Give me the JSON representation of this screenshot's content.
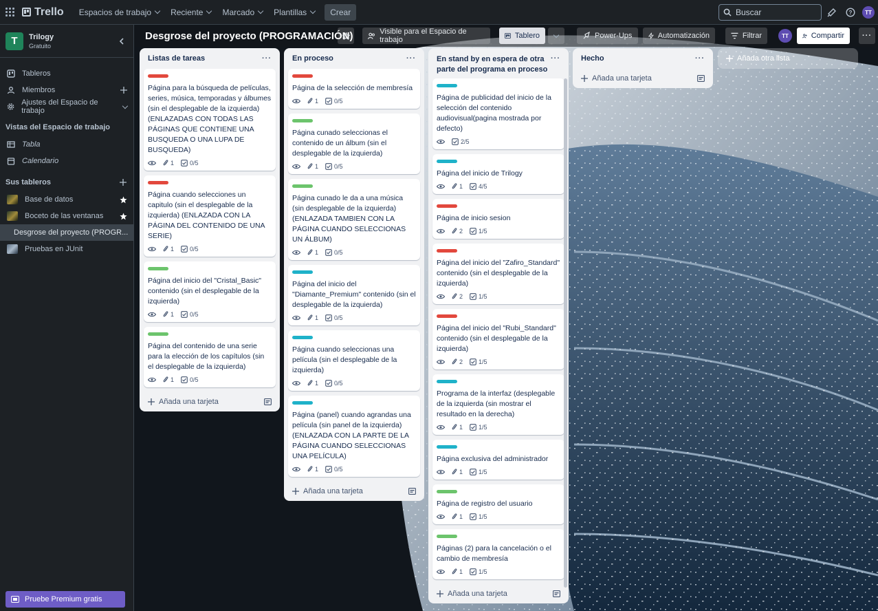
{
  "topbar": {
    "brand": "Trello",
    "nav": [
      {
        "label": "Espacios de trabajo"
      },
      {
        "label": "Reciente"
      },
      {
        "label": "Marcado"
      },
      {
        "label": "Plantillas"
      }
    ],
    "create_label": "Crear",
    "search_placeholder": "Buscar",
    "avatar_initials": "TT"
  },
  "sidebar": {
    "workspace_initial": "T",
    "workspace_name": "Trilogy",
    "workspace_plan": "Gratuito",
    "items": [
      {
        "label": "Tableros",
        "icon": "board-icon"
      },
      {
        "label": "Miembros",
        "icon": "person-icon"
      },
      {
        "label": "Ajustes del Espacio de trabajo",
        "icon": "gear-icon"
      }
    ],
    "views_heading": "Vistas del Espacio de trabajo",
    "views": [
      {
        "label": "Tabla",
        "icon": "table-icon"
      },
      {
        "label": "Calendario",
        "icon": "calendar-icon"
      }
    ],
    "boards_heading": "Sus tableros",
    "boards": [
      {
        "label": "Base de datos",
        "starred": true
      },
      {
        "label": "Boceto de las ventanas",
        "starred": true
      },
      {
        "label": "Desgrose del proyecto (PROGR...",
        "active": true
      },
      {
        "label": "Pruebas en JUnit"
      }
    ],
    "premium_label": "Pruebe Premium gratis"
  },
  "board": {
    "title": "Desgrose del proyecto (PROGRAMACIÓN)",
    "visibility_label": "Visible para el Espacio de trabajo",
    "view_label": "Tablero",
    "powerups_label": "Power-Ups",
    "automation_label": "Automatización",
    "filter_label": "Filtrar",
    "member_initials": "TT",
    "share_label": "Compartir",
    "add_list_label": "Añada otra lista",
    "add_card_label": "Añada una tarjeta"
  },
  "colors": {
    "red": "#e2483d",
    "green": "#6cc46c",
    "cyan": "#1fb2c9"
  },
  "lists": [
    {
      "title": "Listas de tareas",
      "cards": [
        {
          "label": "red",
          "title": "Página para la búsqueda de películas, series, música, temporadas y álbumes (sin el desplegable de la izquierda) (ENLAZADAS CON TODAS LAS PÁGINAS QUE CONTIENE UNA BUSQUEDA O UNA LUPA DE BUSQUEDA)",
          "attachments": "1",
          "checklist": "0/5"
        },
        {
          "label": "red",
          "title": "Página cuando selecciones un capitulo (sin el desplegable de la izquierda) (ENLAZADA CON LA PÁGINA DEL CONTENIDO DE UNA SERIE)",
          "attachments": "1",
          "checklist": "0/5"
        },
        {
          "label": "green",
          "title": "Página del inicio del \"Cristal_Basic\" contenido (sin el desplegable de la izquierda)",
          "attachments": "1",
          "checklist": "0/5"
        },
        {
          "label": "green",
          "title": "Página del contenido de una serie para la elección de los capítulos (sin el desplegable de la izquierda)",
          "attachments": "1",
          "checklist": "0/5"
        }
      ]
    },
    {
      "title": "En proceso",
      "cards": [
        {
          "label": "red",
          "title": "Página de la selección de membresía",
          "attachments": "1",
          "checklist": "0/5"
        },
        {
          "label": "green",
          "title": "Página cunado seleccionas el contenido de un álbum (sin el desplegable de la izquierda)",
          "attachments": "1",
          "checklist": "0/5"
        },
        {
          "label": "green",
          "title": "Página cunado le da a una música (sin desplegable de la izquierda) (ENLAZADA TAMBIEN CON LA PÁGINA CUANDO SELECCIONAS UN ÁLBUM)",
          "attachments": "1",
          "checklist": "0/5"
        },
        {
          "label": "cyan",
          "title": "Página del inicio del \"Diamante_Premium\" contenido (sin el desplegable de la izquierda)",
          "attachments": "1",
          "checklist": "0/5"
        },
        {
          "label": "cyan",
          "title": "Página cuando seleccionas una película (sin el desplegable de la izquierda)",
          "attachments": "1",
          "checklist": "0/5"
        },
        {
          "label": "cyan",
          "title": "Página (panel) cuando agrandas una película (sin panel de la izquierda) (ENLAZADA CON LA PARTE DE LA PÁGINA CUANDO SELECCIONAS UNA PELÍCULA)",
          "attachments": "1",
          "checklist": "0/5"
        }
      ]
    },
    {
      "title": "En stand by en espera de otra parte del programa en proceso",
      "cards": [
        {
          "label": "cyan",
          "title": "Página de publicidad del inicio de la selección del contenido audiovisual(pagina mostrada por defecto)",
          "attachments": "",
          "checklist": "2/5"
        },
        {
          "label": "cyan",
          "title": "Página del inicio de Trilogy",
          "attachments": "1",
          "checklist": "4/5"
        },
        {
          "label": "red",
          "title": "Página de inicio sesion",
          "attachments": "2",
          "checklist": "1/5"
        },
        {
          "label": "red",
          "title": "Página del inicio del \"Zafiro_Standard\" contenido (sin el desplegable de la izquierda)",
          "attachments": "2",
          "checklist": "1/5"
        },
        {
          "label": "red",
          "title": "Página del inicio del \"Rubi_Standard\" contenido (sin el desplegable de la izquierda)",
          "attachments": "2",
          "checklist": "1/5"
        },
        {
          "label": "cyan",
          "title": "Programa de la interfaz (desplegable de la izquierda (sin mostrar el resultado en la derecha)",
          "attachments": "1",
          "checklist": "1/5"
        },
        {
          "label": "cyan",
          "title": "Página exclusiva del administrador",
          "attachments": "1",
          "checklist": "1/5"
        },
        {
          "label": "green",
          "title": "Página de registro del usuario",
          "attachments": "1",
          "checklist": "1/5"
        },
        {
          "label": "green",
          "title": "Páginas (2) para la cancelación o el cambio de membresía",
          "attachments": "1",
          "checklist": "1/5"
        }
      ]
    },
    {
      "title": "Hecho",
      "cards": []
    }
  ]
}
